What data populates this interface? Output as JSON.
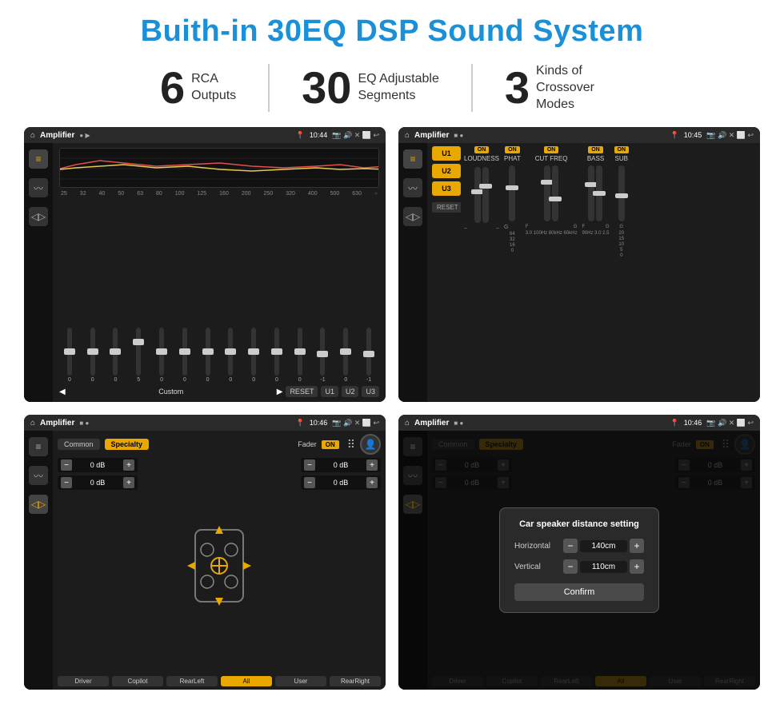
{
  "title": "Buith-in 30EQ DSP Sound System",
  "stats": [
    {
      "number": "6",
      "label": "RCA\nOutputs"
    },
    {
      "number": "30",
      "label": "EQ Adjustable\nSegments"
    },
    {
      "number": "3",
      "label": "Kinds of\nCrossover Modes"
    }
  ],
  "screens": [
    {
      "id": "screen1",
      "status": {
        "title": "Amplifier",
        "time": "10:44"
      },
      "type": "eq",
      "freqs": [
        "25",
        "32",
        "40",
        "50",
        "63",
        "80",
        "100",
        "125",
        "160",
        "200",
        "250",
        "320",
        "400",
        "500",
        "630"
      ],
      "slider_vals": [
        "0",
        "0",
        "0",
        "5",
        "0",
        "0",
        "0",
        "0",
        "0",
        "0",
        "0",
        "-1",
        "0",
        "-1"
      ],
      "bottom_btns": [
        "Custom",
        "RESET",
        "U1",
        "U2",
        "U3"
      ]
    },
    {
      "id": "screen2",
      "status": {
        "title": "Amplifier",
        "time": "10:45"
      },
      "type": "amp2",
      "presets": [
        "U1",
        "U2",
        "U3"
      ],
      "channels": [
        {
          "label": "LOUDNESS",
          "on": true
        },
        {
          "label": "PHAT",
          "on": true
        },
        {
          "label": "CUT FREQ",
          "on": true
        },
        {
          "label": "BASS",
          "on": true
        },
        {
          "label": "SUB",
          "on": true
        }
      ]
    },
    {
      "id": "screen3",
      "status": {
        "title": "Amplifier",
        "time": "10:46"
      },
      "type": "fader",
      "tabs": [
        "Common",
        "Specialty"
      ],
      "fader_label": "Fader",
      "on": true,
      "db_values": [
        "0 dB",
        "0 dB",
        "0 dB",
        "0 dB"
      ],
      "bottom_btns": [
        "Driver",
        "Copilot",
        "RearLeft",
        "All",
        "User",
        "RearRight"
      ]
    },
    {
      "id": "screen4",
      "status": {
        "title": "Amplifier",
        "time": "10:46"
      },
      "type": "fader_dialog",
      "tabs": [
        "Common",
        "Specialty"
      ],
      "dialog": {
        "title": "Car speaker distance setting",
        "rows": [
          {
            "label": "Horizontal",
            "value": "140cm"
          },
          {
            "label": "Vertical",
            "value": "110cm"
          }
        ],
        "confirm_label": "Confirm"
      },
      "db_values": [
        "0 dB",
        "0 dB"
      ],
      "bottom_btns": [
        "Driver",
        "Copilot",
        "RearLeft",
        "All",
        "User",
        "RearRight"
      ]
    }
  ],
  "colors": {
    "accent": "#e8a800",
    "blue": "#1a90d9",
    "dark": "#1c1c1c",
    "text_light": "#ffffff",
    "text_muted": "#888888"
  }
}
